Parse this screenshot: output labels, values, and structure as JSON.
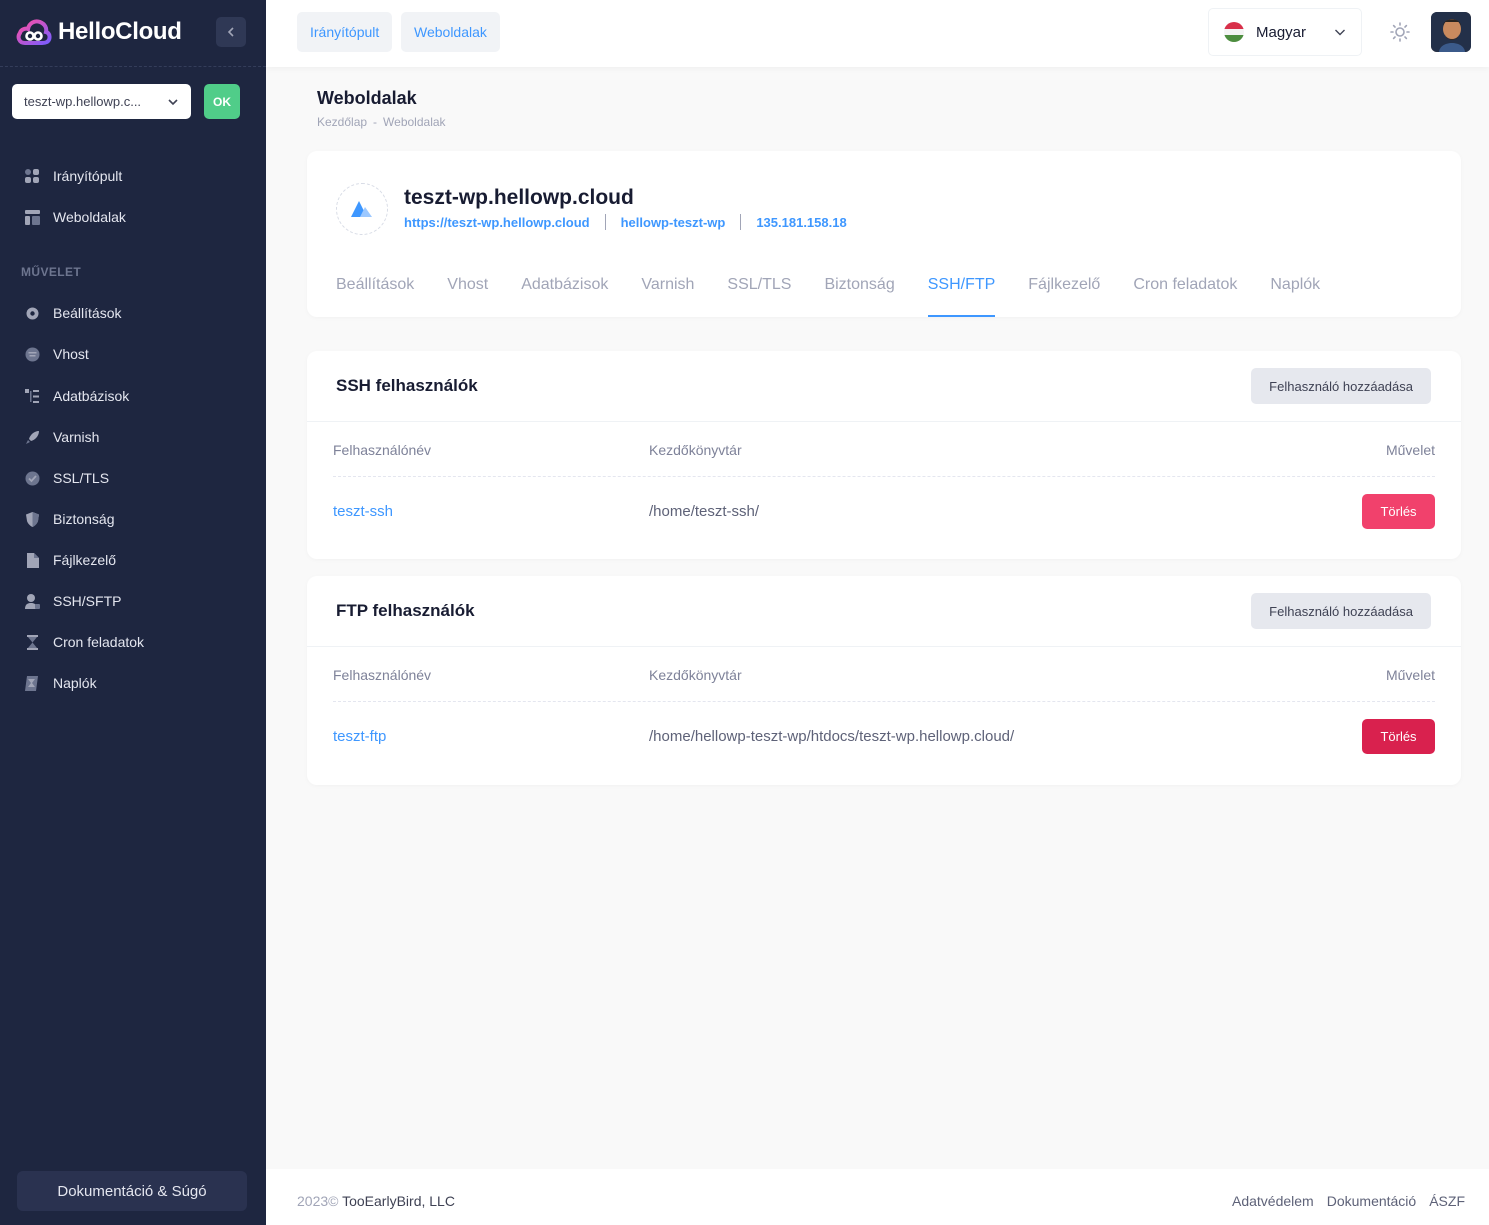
{
  "brand": {
    "name": "HelloCloud"
  },
  "sidebar": {
    "site_select_value": "teszt-wp.hellowp.c...",
    "ok_label": "OK",
    "top_items": [
      {
        "label": "Irányítópult",
        "icon": "dashboard-icon"
      },
      {
        "label": "Weboldalak",
        "icon": "layout-icon"
      }
    ],
    "section_label": "MŰVELET",
    "items": [
      {
        "label": "Beállítások",
        "icon": "gear-icon"
      },
      {
        "label": "Vhost",
        "icon": "server-icon"
      },
      {
        "label": "Adatbázisok",
        "icon": "list-tree-icon"
      },
      {
        "label": "Varnish",
        "icon": "rocket-icon"
      },
      {
        "label": "SSL/TLS",
        "icon": "shield-check-icon"
      },
      {
        "label": "Biztonság",
        "icon": "shield-icon"
      },
      {
        "label": "Fájlkezelő",
        "icon": "file-icon"
      },
      {
        "label": "SSH/SFTP",
        "icon": "user-lock-icon"
      },
      {
        "label": "Cron feladatok",
        "icon": "hourglass-icon"
      },
      {
        "label": "Naplók",
        "icon": "scroll-icon"
      }
    ],
    "docs_label": "Dokumentáció & Súgó"
  },
  "header": {
    "buttons": [
      "Irányítópult",
      "Weboldalak"
    ],
    "language": "Magyar"
  },
  "page": {
    "title": "Weboldalak",
    "breadcrumb": [
      "Kezdőlap",
      "-",
      "Weboldalak"
    ]
  },
  "site": {
    "name": "teszt-wp.hellowp.cloud",
    "url": "https://teszt-wp.hellowp.cloud",
    "system_user": "hellowp-teszt-wp",
    "ip": "135.181.158.18",
    "tabs": [
      "Beállítások",
      "Vhost",
      "Adatbázisok",
      "Varnish",
      "SSL/TLS",
      "Biztonság",
      "SSH/FTP",
      "Fájlkezelő",
      "Cron feladatok",
      "Naplók"
    ],
    "active_tab": "SSH/FTP"
  },
  "ssh": {
    "title": "SSH felhasználók",
    "add_label": "Felhasználó hozzáadása",
    "columns": [
      "Felhasználónév",
      "Kezdőkönyvtár",
      "Művelet"
    ],
    "rows": [
      {
        "user": "teszt-ssh",
        "dir": "/home/teszt-ssh/",
        "action": "Törlés"
      }
    ]
  },
  "ftp": {
    "title": "FTP felhasználók",
    "add_label": "Felhasználó hozzáadása",
    "columns": [
      "Felhasználónév",
      "Kezdőkönyvtár",
      "Művelet"
    ],
    "rows": [
      {
        "user": "teszt-ftp",
        "dir": "/home/hellowp-teszt-wp/htdocs/teszt-wp.hellowp.cloud/",
        "action": "Törlés"
      }
    ]
  },
  "footer": {
    "year": "2023©",
    "company": "TooEarlyBird, LLC",
    "links": [
      "Adatvédelem",
      "Dokumentáció",
      "ÁSZF"
    ]
  },
  "colors": {
    "sidebar_bg": "#1e2640",
    "primary": "#3e97ff",
    "success": "#50cd89",
    "danger_light": "#f1416c",
    "danger": "#d9214e"
  }
}
